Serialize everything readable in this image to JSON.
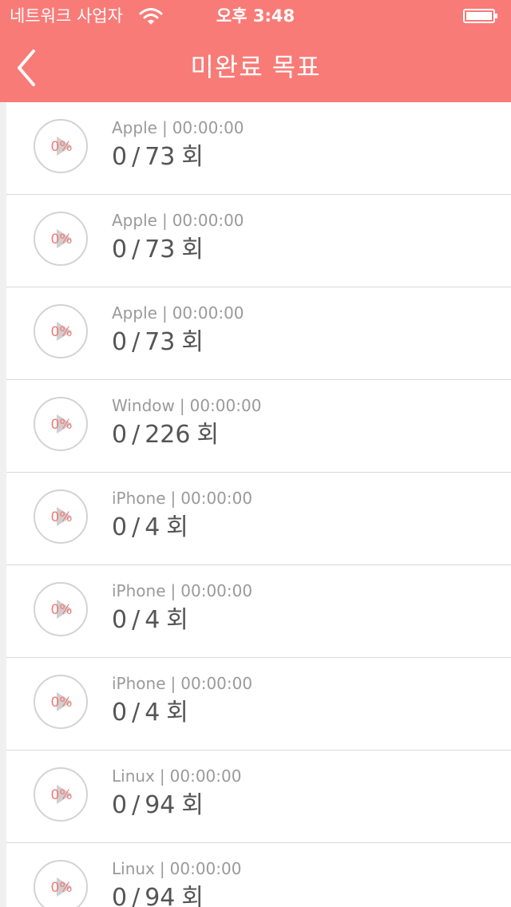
{
  "status_bar": {
    "carrier": "네트워크 사업자",
    "time": "오후 3:48"
  },
  "nav": {
    "title": "미완료 목표",
    "back_icon": "chevron-left-icon"
  },
  "colors": {
    "accent": "#f87b77",
    "percent_text": "#f47a78"
  },
  "goals": [
    {
      "name": "Apple",
      "elapsed": "00:00:00",
      "percent": "0%",
      "done": "0",
      "total": "73",
      "unit": "회"
    },
    {
      "name": "Apple",
      "elapsed": "00:00:00",
      "percent": "0%",
      "done": "0",
      "total": "73",
      "unit": "회"
    },
    {
      "name": "Apple",
      "elapsed": "00:00:00",
      "percent": "0%",
      "done": "0",
      "total": "73",
      "unit": "회"
    },
    {
      "name": "Window",
      "elapsed": "00:00:00",
      "percent": "0%",
      "done": "0",
      "total": "226",
      "unit": "회"
    },
    {
      "name": "iPhone",
      "elapsed": "00:00:00",
      "percent": "0%",
      "done": "0",
      "total": "4",
      "unit": "회"
    },
    {
      "name": "iPhone",
      "elapsed": "00:00:00",
      "percent": "0%",
      "done": "0",
      "total": "4",
      "unit": "회"
    },
    {
      "name": "iPhone",
      "elapsed": "00:00:00",
      "percent": "0%",
      "done": "0",
      "total": "4",
      "unit": "회"
    },
    {
      "name": "Linux",
      "elapsed": "00:00:00",
      "percent": "0%",
      "done": "0",
      "total": "94",
      "unit": "회"
    },
    {
      "name": "Linux",
      "elapsed": "00:00:00",
      "percent": "0%",
      "done": "0",
      "total": "94",
      "unit": "회"
    }
  ]
}
